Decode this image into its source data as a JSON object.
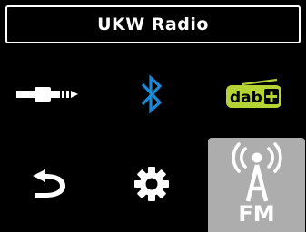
{
  "header": {
    "title": "UKW Radio"
  },
  "menu": {
    "items": [
      {
        "id": "aux",
        "icon": "aux-jack-icon",
        "selected": false
      },
      {
        "id": "bluetooth",
        "icon": "bluetooth-icon",
        "selected": false
      },
      {
        "id": "dab",
        "icon": "dab-plus-icon",
        "selected": false
      },
      {
        "id": "back",
        "icon": "back-arrow-icon",
        "selected": false
      },
      {
        "id": "settings",
        "icon": "gear-icon",
        "selected": false
      },
      {
        "id": "fm",
        "icon": "fm-antenna-icon",
        "label": "FM",
        "selected": true
      }
    ]
  },
  "colors": {
    "bluetooth": "#1e88d8",
    "dab": "#b5d334",
    "selected_bg": "#adadad"
  }
}
